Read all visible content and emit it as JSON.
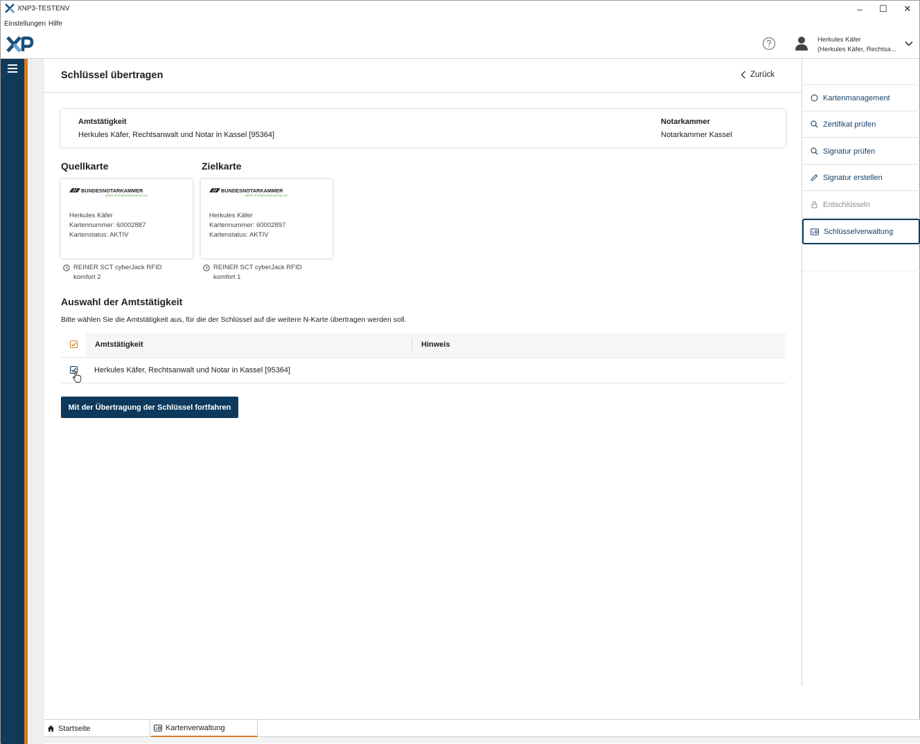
{
  "window": {
    "title": "XNP3-TESTENV",
    "minimize": "–",
    "maximize": "☐",
    "close": "✕"
  },
  "menu": {
    "settings": "Einstellungen",
    "help": "Hilfe"
  },
  "header": {
    "user_name": "Herkules Käfer",
    "user_sub": "(Herkules Käfer, Rechtsa..."
  },
  "page": {
    "title": "Schlüssel übertragen",
    "back": "Zurück"
  },
  "info": {
    "office_label": "Amtstätigkeit",
    "office_value": "Herkules Käfer, Rechtsanwalt und Notar in Kassel [95364]",
    "chamber_label": "Notarkammer",
    "chamber_value": "Notarkammer Kassel"
  },
  "source_card": {
    "heading": "Quellkarte",
    "issuer": "BUNDESNOTARKAMMER",
    "issuer_sub": "ZERTIFIZIERUNGSSTELLE",
    "holder": "Herkules Käfer",
    "number": "Kartennummer: 60002887",
    "status": "Kartenstatus: AKTIV",
    "reader_line1": "REINER SCT cyberJack RFID",
    "reader_line2": "komfort 2"
  },
  "target_card": {
    "heading": "Zielkarte",
    "issuer": "BUNDESNOTARKAMMER",
    "issuer_sub": "ZERTIFIZIERUNGSSTELLE",
    "holder": "Herkules Käfer",
    "number": "Kartennummer: 60002897",
    "status": "Kartenstatus: AKTIV",
    "reader_line1": "REINER SCT cyberJack RFID",
    "reader_line2": "komfort 1"
  },
  "selection": {
    "heading": "Auswahl der Amtstätigkeit",
    "description": "Bitte wählen Sie die Amtstätigkeit aus, für die der Schlüssel auf die weitere N-Karte übertragen werden soll.",
    "columns": [
      "Amtstätigkeit",
      "Hinweis"
    ],
    "rows": [
      {
        "office": "Herkules Käfer, Rechtsanwalt und Notar in Kassel [95364]",
        "hint": "",
        "checked": true
      }
    ],
    "button": "Mit der Übertragung der Schlüssel fortfahren"
  },
  "sidebar": {
    "items": [
      {
        "label": "Kartenmanagement",
        "icon": "circle-icon",
        "state": "normal"
      },
      {
        "label": "Zertifikat prüfen",
        "icon": "search-icon",
        "state": "normal"
      },
      {
        "label": "Signatur prüfen",
        "icon": "search-icon",
        "state": "normal"
      },
      {
        "label": "Signatur erstellen",
        "icon": "pen-icon",
        "state": "normal"
      },
      {
        "label": "Entschlüsseln",
        "icon": "lock-icon",
        "state": "disabled"
      },
      {
        "label": "Schlüsselverwaltung",
        "icon": "card-icon",
        "state": "active"
      }
    ]
  },
  "bottom_tabs": {
    "home": "Startseite",
    "cards": "Kartenverwaltung"
  },
  "colors": {
    "primary": "#0d3a5c",
    "accent": "#d97a1e",
    "link": "#15406a"
  }
}
